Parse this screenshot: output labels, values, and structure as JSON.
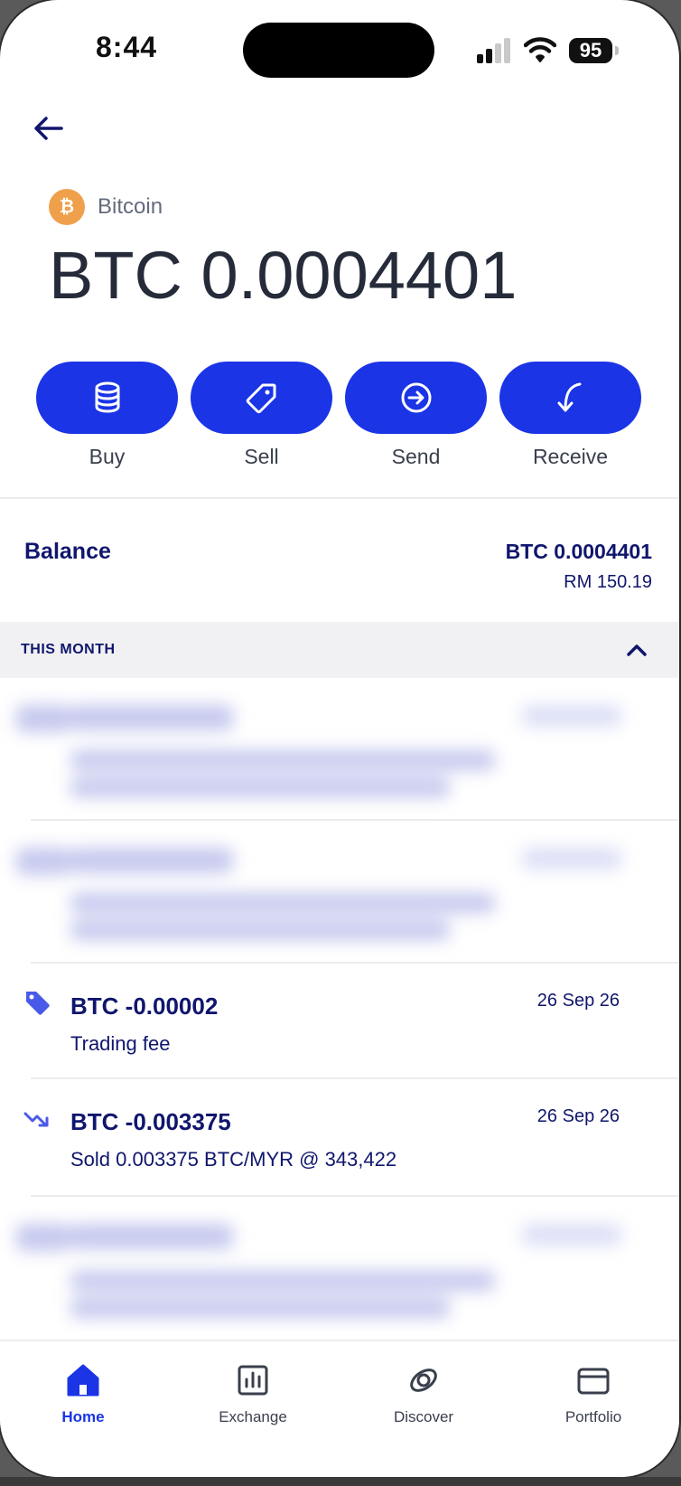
{
  "status_bar": {
    "time": "8:44",
    "battery": "95"
  },
  "header": {
    "back_icon": "arrow-left-icon",
    "coin_symbol": "₿",
    "coin_name": "Bitcoin",
    "balance": "BTC 0.0004401"
  },
  "actions": [
    {
      "label": "Buy",
      "icon": "coins-stack-icon"
    },
    {
      "label": "Sell",
      "icon": "tag-icon"
    },
    {
      "label": "Send",
      "icon": "arrow-circle-right-icon"
    },
    {
      "label": "Receive",
      "icon": "arrow-curve-down-icon"
    }
  ],
  "balance_row": {
    "label": "Balance",
    "btc": "BTC 0.0004401",
    "fiat": "RM 150.19"
  },
  "section": {
    "label": "THIS MONTH"
  },
  "transactions": [
    {
      "amount": "BTC -0.00002",
      "date": "26 Sep 26",
      "description": "Trading fee",
      "icon": "tag-icon"
    },
    {
      "amount": "BTC -0.003375",
      "date": "26 Sep 26",
      "description": "Sold 0.003375 BTC/MYR @ 343,422",
      "icon": "trend-down-icon"
    }
  ],
  "nav": [
    {
      "label": "Home",
      "icon": "home-icon",
      "active": true
    },
    {
      "label": "Exchange",
      "icon": "bar-chart-icon",
      "active": false
    },
    {
      "label": "Discover",
      "icon": "orbit-icon",
      "active": false
    },
    {
      "label": "Portfolio",
      "icon": "wallet-icon",
      "active": false
    }
  ],
  "colors": {
    "primary": "#1a34e6",
    "navy": "#10166d",
    "bitcoin": "#f0a04b"
  }
}
